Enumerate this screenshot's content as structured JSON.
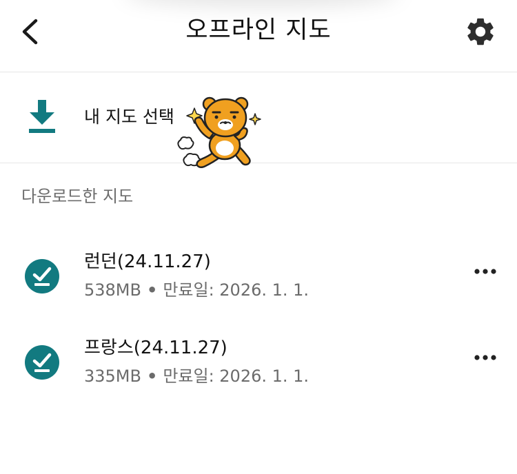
{
  "header": {
    "title": "오프라인 지도",
    "back_icon": "chevron-left-icon",
    "settings_icon": "gear-icon"
  },
  "select_map": {
    "label": "내 지도 선택",
    "icon": "download-icon",
    "sticker": "ryan-character-sticker"
  },
  "downloaded": {
    "section_label": "다운로드한 지도",
    "items": [
      {
        "name": "런던(24.11.27)",
        "size": "538MB",
        "separator": "•",
        "expiry": "만료일: 2026. 1. 1."
      },
      {
        "name": "프랑스(24.11.27)",
        "size": "335MB",
        "separator": "•",
        "expiry": "만료일: 2026. 1. 1."
      }
    ]
  },
  "colors": {
    "accent": "#127a80",
    "text_primary": "#111111",
    "text_secondary": "#6b6b6b",
    "divider": "#e6e6e6",
    "icon_dark": "#2d2d2d"
  }
}
